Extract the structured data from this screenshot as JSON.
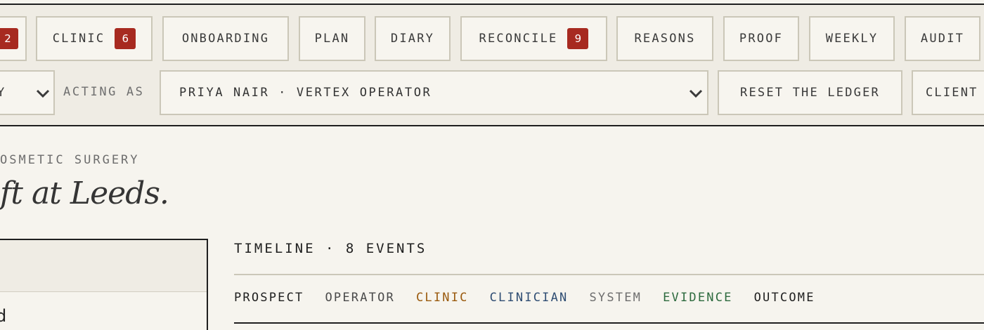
{
  "nav": {
    "tabs": [
      {
        "label": "",
        "badge": "2"
      },
      {
        "label": "CLINIC",
        "badge": "6"
      },
      {
        "label": "ONBOARDING",
        "badge": ""
      },
      {
        "label": "PLAN",
        "badge": ""
      },
      {
        "label": "DIARY",
        "badge": ""
      },
      {
        "label": "RECONCILE",
        "badge": "9"
      },
      {
        "label": "REASONS",
        "badge": ""
      },
      {
        "label": "PROOF",
        "badge": ""
      },
      {
        "label": "WEEKLY",
        "badge": ""
      },
      {
        "label": "AUDIT",
        "badge": ""
      }
    ]
  },
  "controls": {
    "view_select_value": "Y",
    "acting_as_label": "ACTING AS",
    "persona_value": "PRIYA NAIR · VERTEX OPERATOR",
    "reset_label": "RESET THE LEDGER",
    "client_label": "CLIENT"
  },
  "content": {
    "eyebrow": "OSMETIC SURGERY",
    "headline": "ft at Leeds.",
    "left_card_item": "d"
  },
  "timeline": {
    "heading": "TIMELINE · 8 EVENTS",
    "filters": [
      {
        "label": "PROSPECT",
        "color": "#1f1f1f"
      },
      {
        "label": "OPERATOR",
        "color": "#4a4a4a"
      },
      {
        "label": "CLINIC",
        "color": "#9a5a0e"
      },
      {
        "label": "CLINICIAN",
        "color": "#2f4d73"
      },
      {
        "label": "SYSTEM",
        "color": "#6e6e6e"
      },
      {
        "label": "EVIDENCE",
        "color": "#2d6a3e"
      },
      {
        "label": "OUTCOME",
        "color": "#1f1f1f"
      }
    ]
  },
  "colors": {
    "accent_badge": "#a72a20",
    "background": "#f6f4ee",
    "chrome": "#efece4"
  }
}
